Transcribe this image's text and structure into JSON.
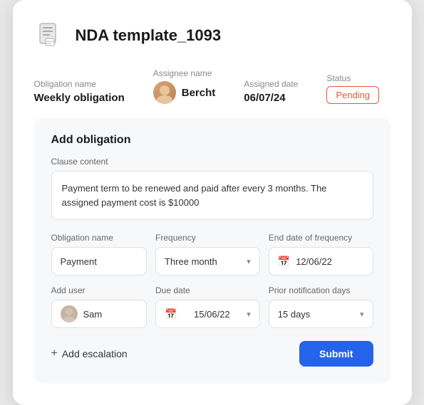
{
  "header": {
    "title": "NDA template_1093"
  },
  "meta": {
    "obligation_label": "Obligation name",
    "obligation_value": "Weekly obligation",
    "assignee_label": "Assignee name",
    "assignee_value": "Bercht",
    "assigned_date_label": "Assigned date",
    "assigned_date_value": "06/07/24",
    "status_label": "Status",
    "status_value": "Pending"
  },
  "form": {
    "title": "Add obligation",
    "clause_label": "Clause content",
    "clause_text": "Payment term to be renewed and paid after every 3 months. The assigned payment cost is $10000",
    "obligation_name_label": "Obligation name",
    "obligation_name_value": "Payment",
    "frequency_label": "Frequency",
    "frequency_value": "Three month",
    "end_date_label": "End date of frequency",
    "end_date_value": "12/06/22",
    "add_user_label": "Add user",
    "add_user_value": "Sam",
    "due_date_label": "Due date",
    "due_date_value": "15/06/22",
    "prior_notification_label": "Prior notification days",
    "prior_notification_value": "15 days",
    "add_escalation_label": "Add escalation",
    "submit_label": "Submit"
  }
}
